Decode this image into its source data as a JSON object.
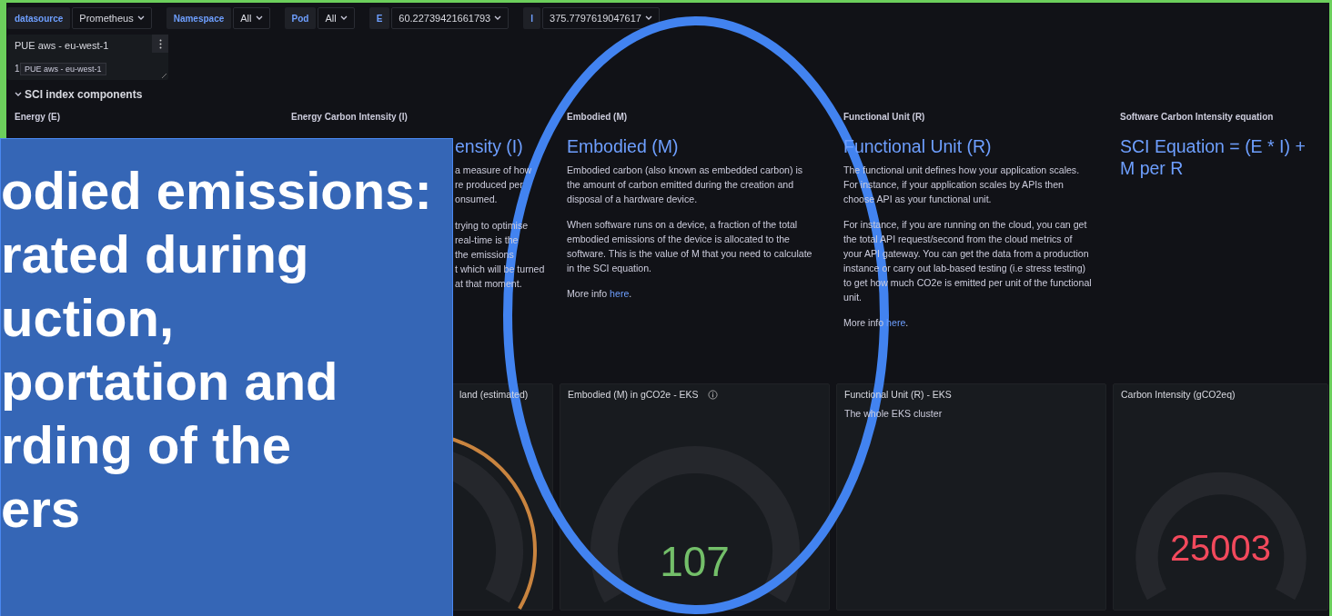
{
  "variables": [
    {
      "label": "datasource",
      "value": "Prometheus"
    },
    {
      "label": "Namespace",
      "value": "All"
    },
    {
      "label": "Pod",
      "value": "All"
    },
    {
      "label": "E",
      "value": "60.22739421661793"
    },
    {
      "label": "I",
      "value": "375.7797619047617"
    }
  ],
  "text_panel": {
    "title": "PUE aws - eu-west-1",
    "value": "1",
    "tooltip": "PUE aws - eu-west-1"
  },
  "row": {
    "title": "SCI index components",
    "expanded": true
  },
  "info_panels": [
    {
      "title": "Energy (E)"
    },
    {
      "title": "Energy Carbon Intensity (I)",
      "heading": "ensity (I)",
      "line_groups": [
        [
          "a measure of how",
          "re produced per",
          "onsumed."
        ],
        [
          "trying to optimise",
          "real-time is the",
          "the emissions",
          "t which will be turned",
          "at that moment."
        ]
      ]
    },
    {
      "title": "Embodied (M)",
      "heading": "Embodied (M)",
      "paragraphs": [
        "Embodied carbon (also known as embedded carbon) is the amount of carbon emitted during the creation and disposal of a hardware device.",
        "When software runs on a device, a fraction of the total embodied emissions of the device is allocated to the software. This is the value of M that you need to calculate in the SCI equation."
      ],
      "more_info": {
        "prefix": "More info ",
        "link": "here",
        "suffix": "."
      }
    },
    {
      "title": "Functional Unit (R)",
      "heading": "Functional Unit (R)",
      "paragraphs": [
        "The functional unit defines how your application scales. For instance, if your application scales by APIs then choose API as your functional unit.",
        "For instance, if you are running on the cloud, you can get the total API request/second from the cloud metrics of your API gateway. You can get the data from a production instance or carry out lab-based testing (i.e stress testing) to get how much CO2e is emitted per unit of the functional unit."
      ],
      "more_info": {
        "prefix": "More info ",
        "link": "here",
        "suffix": "."
      }
    },
    {
      "title": "Software Carbon Intensity equation",
      "heading": "SCI Equation = (E * I) + M per R"
    }
  ],
  "metric_panels": [
    {
      "kind": "gauge",
      "title": "land (estimated)",
      "threshold_ring": true,
      "color": "#c9843f"
    },
    {
      "kind": "gauge",
      "title": "Embodied (M) in gCO2e - EKS",
      "info": true,
      "value": "107",
      "color": "#73bf69"
    },
    {
      "kind": "text",
      "title": "Functional Unit (R) - EKS",
      "body": "The whole EKS cluster"
    },
    {
      "kind": "gauge",
      "title": "Carbon Intensity (gCO2eq)",
      "value": "25003",
      "color": "#f2495c"
    }
  ],
  "annotation": {
    "lines": [
      "odied emissions:",
      "rated during",
      "uction,",
      "portation and",
      "rding of the",
      "ers"
    ]
  }
}
